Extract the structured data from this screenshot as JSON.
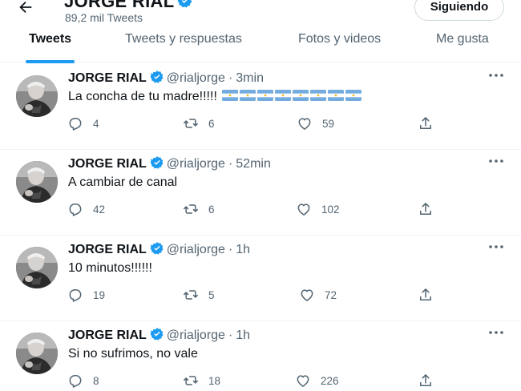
{
  "profile": {
    "name": "JORGE RIAL",
    "tweet_count": "89,2 mil Tweets",
    "follow_label": "Siguiendo"
  },
  "tabs": [
    {
      "label": "Tweets",
      "active": true
    },
    {
      "label": "Tweets y respuestas",
      "active": false
    },
    {
      "label": "Fotos y videos",
      "active": false
    },
    {
      "label": "Me gusta",
      "active": false
    }
  ],
  "tweets": [
    {
      "name": "JORGE RIAL",
      "handle": "@rialjorge",
      "dot": "·",
      "time": "3min",
      "text": "La concha de tu madre!!!!!",
      "flags": 8,
      "replies": "4",
      "retweets": "6",
      "likes": "59"
    },
    {
      "name": "JORGE RIAL",
      "handle": "@rialjorge",
      "dot": "·",
      "time": "52min",
      "text": "A cambiar de canal",
      "flags": 0,
      "replies": "42",
      "retweets": "6",
      "likes": "102"
    },
    {
      "name": "JORGE RIAL",
      "handle": "@rialjorge",
      "dot": "·",
      "time": "1h",
      "text": "10 minutos!!!!!!",
      "flags": 0,
      "replies": "19",
      "retweets": "5",
      "likes": "72"
    },
    {
      "name": "JORGE RIAL",
      "handle": "@rialjorge",
      "dot": "·",
      "time": "1h",
      "text": "Si no sufrimos, no vale",
      "flags": 0,
      "replies": "8",
      "retweets": "18",
      "likes": "226"
    }
  ],
  "icons": {
    "back": "arrow-left-icon",
    "verified": "verified-badge-icon",
    "more": "more-dots-icon",
    "reply": "reply-icon",
    "retweet": "retweet-icon",
    "like": "heart-icon",
    "share": "share-icon",
    "flag": "argentina-flag-emoji"
  },
  "colors": {
    "accent": "#1d9bf0",
    "text": "#0f1419",
    "muted": "#536471",
    "divider": "#eff3f4",
    "flag_blue": "#74acdf"
  }
}
